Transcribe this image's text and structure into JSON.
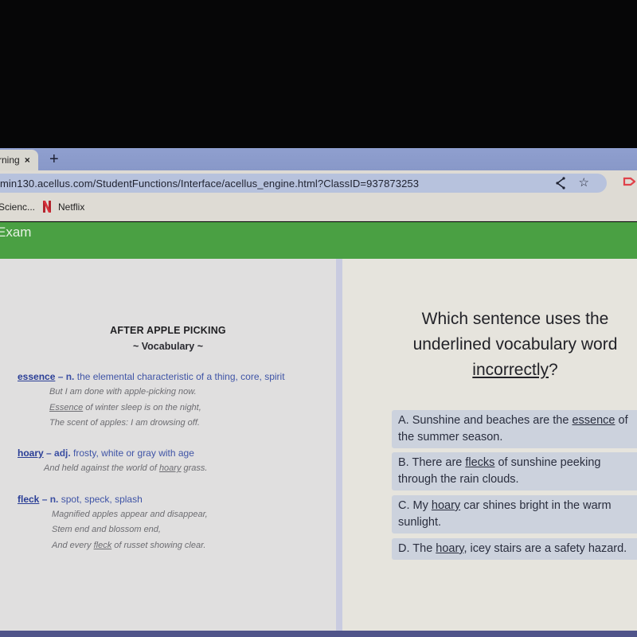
{
  "browser": {
    "tab_title": "rning",
    "tab_close": "×",
    "new_tab": "+",
    "url": "min130.acellus.com/StudentFunctions/Interface/acellus_engine.html?ClassID=937873253",
    "bookmarks": [
      "Scienc...",
      "Netflix"
    ],
    "icons": [
      "share-icon",
      "star-icon",
      "extension-icon",
      "netflix-icon"
    ]
  },
  "header": {
    "title": "Exam",
    "color": "#4aa043"
  },
  "passage": {
    "title": "AFTER APPLE PICKING",
    "subtitle": "~ Vocabulary ~",
    "entries": [
      {
        "word": "essence",
        "dash": " – ",
        "pos": "n.",
        "definition": "the elemental characteristic of a thing, core, spirit",
        "lines": [
          {
            "pre": "But I am done with apple-picking now.",
            "u": "",
            "post": ""
          },
          {
            "pre": "",
            "u": "Essence",
            "post": " of winter sleep is on the night,"
          },
          {
            "pre": "The scent of apples: I am drowsing off.",
            "u": "",
            "post": ""
          }
        ]
      },
      {
        "word": "hoary",
        "dash": " – ",
        "pos": "adj.",
        "definition": "frosty, white or gray with age",
        "lines": [
          {
            "pre": "And held against the world of ",
            "u": "hoary",
            "post": " grass."
          }
        ]
      },
      {
        "word": "fleck",
        "dash": " – ",
        "pos": "n.",
        "definition": "spot, speck, splash",
        "lines": [
          {
            "pre": "Magnified apples appear and disappear,",
            "u": "",
            "post": ""
          },
          {
            "pre": "Stem end and blossom end,",
            "u": "",
            "post": ""
          },
          {
            "pre": "And every ",
            "u": "fleck",
            "post": " of russet showing clear."
          }
        ]
      }
    ]
  },
  "question": {
    "line1": "Which sentence uses the",
    "line2": "underlined vocabulary word",
    "underlined": "incorrectly",
    "end": "?"
  },
  "choices": [
    {
      "pre": "A. Sunshine and beaches are the ",
      "u": "essence",
      "post": " of the summer season."
    },
    {
      "pre": "B. There are ",
      "u": "flecks",
      "post": " of sunshine peeking through the rain clouds."
    },
    {
      "pre": "C. My ",
      "u": "hoary",
      "post": " car shines bright in the warm sunlight."
    },
    {
      "pre": "D. The ",
      "u": "hoary",
      "post": ", icey stairs are a safety hazard."
    }
  ]
}
